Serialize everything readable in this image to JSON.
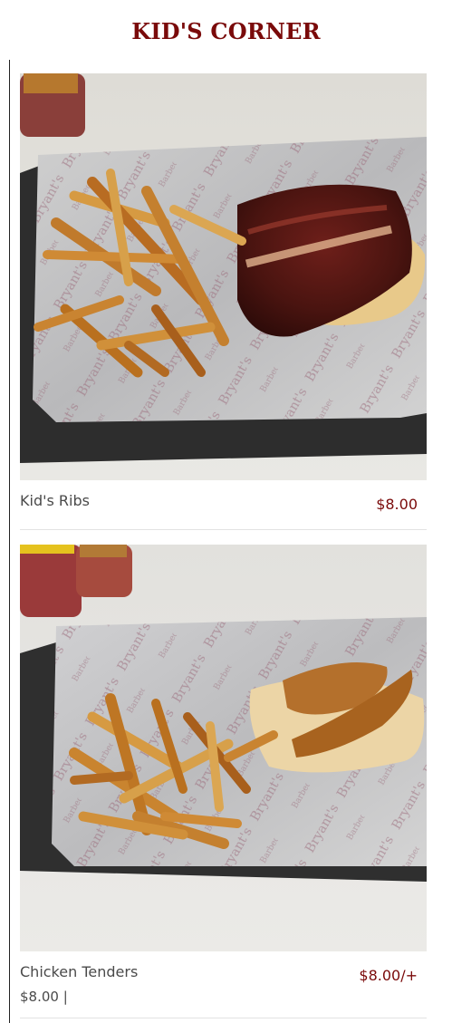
{
  "page": {
    "title": "KID'S CORNER"
  },
  "items": [
    {
      "name": "Kid's Ribs",
      "price": "$8.00",
      "photo_alt": "Kid's Ribs"
    },
    {
      "name": "Chicken Tenders",
      "price": "$8.00/+",
      "variant_price": "$8.00 |",
      "photo_alt": "Chicken Tenders"
    }
  ]
}
